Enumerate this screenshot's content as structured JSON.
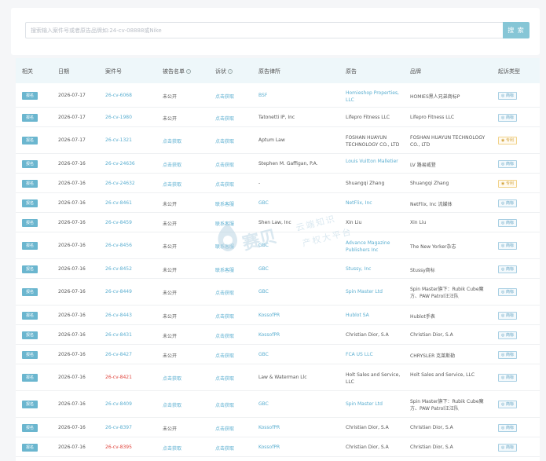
{
  "search": {
    "placeholder": "搜索输入案件号或者原告品牌如:24-cv-08888或Nike",
    "button_label": "搜 索"
  },
  "table": {
    "headers": {
      "tag": "相关",
      "date": "日期",
      "case_no": "案件号",
      "defendant_list": "被告名单",
      "complaint": "诉状",
      "plaintiff_firm": "原告律所",
      "plaintiff": "原告",
      "brand": "品牌",
      "case_type": "起诉类型"
    },
    "rows": [
      {
        "tag": "报名",
        "date": "2026-07-17",
        "case_no": "26-cv-6068",
        "defendant_list": "未公开",
        "complaint": "点击获取",
        "plaintiff_firm": "BSF",
        "plaintiff": "Homieshop Properties, LLC",
        "brand": "HOMIES黑人兄弟商标P",
        "case_type": "商标",
        "case_no_red": false,
        "def_link": false,
        "comp_link": true,
        "firm_link": true,
        "pl_link": true,
        "patent": false
      },
      {
        "tag": "报名",
        "date": "2026-07-17",
        "case_no": "26-cv-1980",
        "defendant_list": "未公开",
        "complaint": "点击获取",
        "plaintiff_firm": "Tatonetti IP, Inc",
        "plaintiff": "Lifepro Fitness LLC",
        "brand": "Lifepro Fitness LLC",
        "case_type": "商标",
        "case_no_red": false,
        "def_link": false,
        "comp_link": true,
        "firm_link": false,
        "pl_link": false,
        "patent": false
      },
      {
        "tag": "报名",
        "date": "2026-07-17",
        "case_no": "26-cv-1321",
        "defendant_list": "点击获取",
        "complaint": "点击获取",
        "plaintiff_firm": "Aptum Law",
        "plaintiff": "FOSHAN HUAYUN TECHNOLOGY CO., LTD",
        "brand": "FOSHAN HUAYUN TECHNOLOGY CO., LTD",
        "case_type": "专利",
        "case_no_red": false,
        "def_link": true,
        "comp_link": true,
        "firm_link": false,
        "pl_link": false,
        "patent": true
      },
      {
        "tag": "报名",
        "date": "2026-07-16",
        "case_no": "26-cv-24636",
        "defendant_list": "点击获取",
        "complaint": "点击获取",
        "plaintiff_firm": "Stephen M. Gaffigan, P.A.",
        "plaintiff": "Louis Vuitton Malletier",
        "brand": "LV 路易威登",
        "case_type": "商标",
        "case_no_red": false,
        "def_link": true,
        "comp_link": true,
        "firm_link": false,
        "pl_link": true,
        "patent": false
      },
      {
        "tag": "报名",
        "date": "2026-07-16",
        "case_no": "26-cv-24632",
        "defendant_list": "点击获取",
        "complaint": "点击获取",
        "plaintiff_firm": "-",
        "plaintiff": "Shuangqi Zhang",
        "brand": "Shuangqi Zhang",
        "case_type": "专利",
        "case_no_red": false,
        "def_link": true,
        "comp_link": true,
        "firm_link": false,
        "pl_link": false,
        "patent": true
      },
      {
        "tag": "报名",
        "date": "2026-07-16",
        "case_no": "26-cv-8461",
        "defendant_list": "未公开",
        "complaint": "联系客服",
        "plaintiff_firm": "GBC",
        "plaintiff": "NetFlix, Inc",
        "brand": "NetFlix, Inc 流媒体",
        "case_type": "商标",
        "case_no_red": false,
        "def_link": false,
        "comp_link": true,
        "firm_link": true,
        "pl_link": true,
        "patent": false
      },
      {
        "tag": "报名",
        "date": "2026-07-16",
        "case_no": "26-cv-8459",
        "defendant_list": "未公开",
        "complaint": "联系客服",
        "plaintiff_firm": "Shen Law, Inc",
        "plaintiff": "Xin Liu",
        "brand": "Xin Liu",
        "case_type": "商标",
        "case_no_red": false,
        "def_link": false,
        "comp_link": true,
        "firm_link": false,
        "pl_link": false,
        "patent": false
      },
      {
        "tag": "报名",
        "date": "2026-07-16",
        "case_no": "26-cv-8456",
        "defendant_list": "未公开",
        "complaint": "联系客服",
        "plaintiff_firm": "GBC",
        "plaintiff": "Advance Magazine Publishers Inc",
        "brand": "The New Yorker杂志",
        "case_type": "商标",
        "case_no_red": false,
        "def_link": false,
        "comp_link": true,
        "firm_link": true,
        "pl_link": true,
        "patent": false
      },
      {
        "tag": "报名",
        "date": "2026-07-16",
        "case_no": "26-cv-8452",
        "defendant_list": "未公开",
        "complaint": "联系客服",
        "plaintiff_firm": "GBC",
        "plaintiff": "Stussy, Inc",
        "brand": "Stussy商标",
        "case_type": "商标",
        "case_no_red": false,
        "def_link": false,
        "comp_link": true,
        "firm_link": true,
        "pl_link": true,
        "patent": false
      },
      {
        "tag": "报名",
        "date": "2026-07-16",
        "case_no": "26-cv-8449",
        "defendant_list": "未公开",
        "complaint": "点击获取",
        "plaintiff_firm": "GBC",
        "plaintiff": "Spin Master Ltd",
        "brand": "Spin Master旗下：Rubik Cube魔方、PAW Patrol汪汪队",
        "case_type": "商标",
        "case_no_red": false,
        "def_link": false,
        "comp_link": true,
        "firm_link": true,
        "pl_link": true,
        "patent": false
      },
      {
        "tag": "报名",
        "date": "2026-07-16",
        "case_no": "26-cv-8443",
        "defendant_list": "未公开",
        "complaint": "点击获取",
        "plaintiff_firm": "KossofPR",
        "plaintiff": "Hublot SA",
        "brand": "Hublot手表",
        "case_type": "商标",
        "case_no_red": false,
        "def_link": false,
        "comp_link": true,
        "firm_link": true,
        "pl_link": true,
        "patent": false
      },
      {
        "tag": "报名",
        "date": "2026-07-16",
        "case_no": "26-cv-8431",
        "defendant_list": "未公开",
        "complaint": "点击获取",
        "plaintiff_firm": "KossofPR",
        "plaintiff": "Christian Dior, S.A",
        "brand": "Christian Dior, S.A",
        "case_type": "商标",
        "case_no_red": false,
        "def_link": false,
        "comp_link": true,
        "firm_link": true,
        "pl_link": false,
        "patent": false
      },
      {
        "tag": "报名",
        "date": "2026-07-16",
        "case_no": "26-cv-8427",
        "defendant_list": "未公开",
        "complaint": "点击获取",
        "plaintiff_firm": "GBC",
        "plaintiff": "FCA US LLC",
        "brand": "CHRYSLER 克莱斯勒",
        "case_type": "商标",
        "case_no_red": false,
        "def_link": false,
        "comp_link": true,
        "firm_link": true,
        "pl_link": true,
        "patent": false
      },
      {
        "tag": "报名",
        "date": "2026-07-16",
        "case_no": "26-cv-8421",
        "defendant_list": "点击获取",
        "complaint": "点击获取",
        "plaintiff_firm": "Law & Waterman Llc",
        "plaintiff": "Holt Sales and Service, LLC",
        "brand": "Holt Sales and Service, LLC",
        "case_type": "商标",
        "case_no_red": true,
        "def_link": true,
        "comp_link": true,
        "firm_link": false,
        "pl_link": false,
        "patent": false
      },
      {
        "tag": "报名",
        "date": "2026-07-16",
        "case_no": "26-cv-8409",
        "defendant_list": "点击获取",
        "complaint": "点击获取",
        "plaintiff_firm": "GBC",
        "plaintiff": "Spin Master Ltd",
        "brand": "Spin Master旗下：Rubik Cube魔方、PAW Patrol汪汪队",
        "case_type": "商标",
        "case_no_red": false,
        "def_link": true,
        "comp_link": true,
        "firm_link": true,
        "pl_link": true,
        "patent": false
      },
      {
        "tag": "报名",
        "date": "2026-07-16",
        "case_no": "26-cv-8397",
        "defendant_list": "未公开",
        "complaint": "点击获取",
        "plaintiff_firm": "KossofPR",
        "plaintiff": "Christian Dior, S.A",
        "brand": "Christian Dior, S.A",
        "case_type": "商标",
        "case_no_red": false,
        "def_link": false,
        "comp_link": true,
        "firm_link": true,
        "pl_link": false,
        "patent": false
      },
      {
        "tag": "报名",
        "date": "2026-07-16",
        "case_no": "26-cv-8395",
        "defendant_list": "点击获取",
        "complaint": "点击获取",
        "plaintiff_firm": "KossofPR",
        "plaintiff": "Christian Dior, S.A",
        "brand": "Christian Dior, S.A",
        "case_type": "商标",
        "case_no_red": true,
        "def_link": true,
        "comp_link": true,
        "firm_link": true,
        "pl_link": false,
        "patent": false
      }
    ]
  },
  "watermark": {
    "big": "赛贝",
    "line1": "云端知识",
    "line2": "产权大平台"
  },
  "colors": {
    "accent": "#6bb6cf",
    "link": "#5aaed0",
    "red": "#e0443c",
    "patent": "#d2a23a"
  }
}
